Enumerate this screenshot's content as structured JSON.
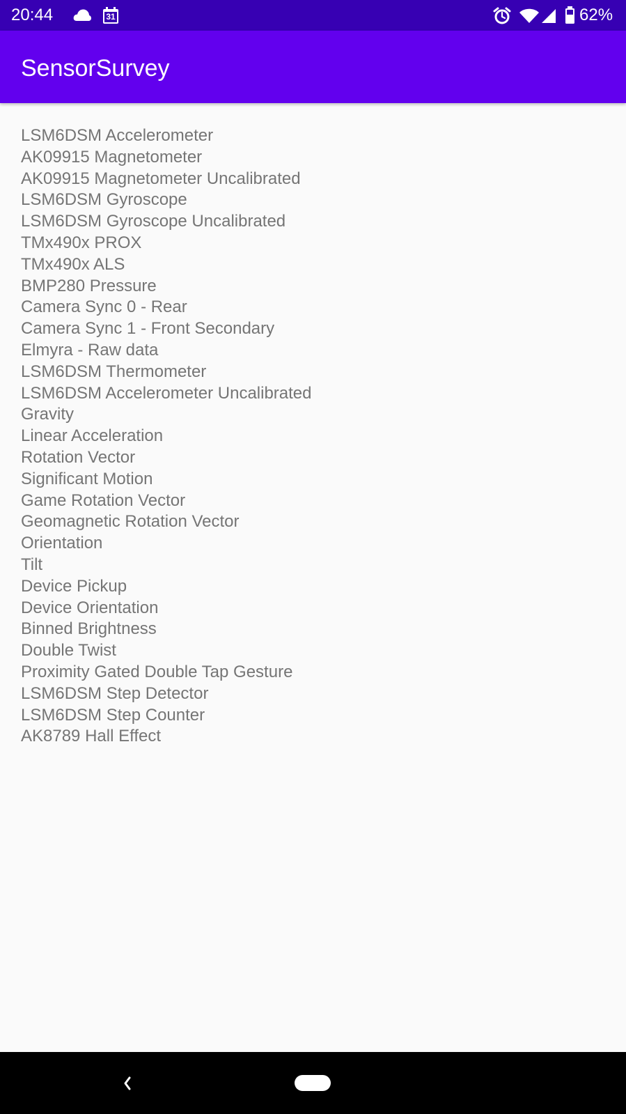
{
  "status_bar": {
    "time": "20:44",
    "calendar_day": "31",
    "battery": "62%",
    "icons": [
      "cloud-icon",
      "calendar-icon",
      "alarm-icon",
      "wifi-icon",
      "signal-icon",
      "battery-icon"
    ]
  },
  "app_bar": {
    "title": "SensorSurvey",
    "color": "#6200ee"
  },
  "sensors": [
    "LSM6DSM Accelerometer",
    "AK09915 Magnetometer",
    "AK09915 Magnetometer Uncalibrated",
    "LSM6DSM Gyroscope",
    "LSM6DSM Gyroscope Uncalibrated",
    "TMx490x PROX",
    "TMx490x ALS",
    "BMP280 Pressure",
    "Camera Sync 0 - Rear",
    "Camera Sync 1 - Front Secondary",
    "Elmyra - Raw data",
    "LSM6DSM Thermometer",
    "LSM6DSM Accelerometer Uncalibrated",
    "Gravity",
    "Linear Acceleration",
    "Rotation Vector",
    "Significant Motion",
    "Game Rotation Vector",
    "Geomagnetic Rotation Vector",
    "Orientation",
    "Tilt",
    "Device Pickup",
    "Device Orientation",
    "Binned Brightness",
    "Double Twist",
    "Proximity Gated Double Tap Gesture",
    "LSM6DSM Step Detector",
    "LSM6DSM Step Counter",
    "AK8789 Hall Effect"
  ],
  "nav_bar": {
    "back_icon": "back-icon",
    "home_icon": "home-pill-icon"
  }
}
